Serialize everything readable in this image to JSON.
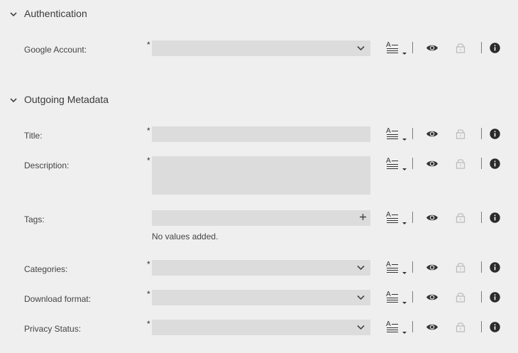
{
  "sections": [
    {
      "title": "Authentication"
    },
    {
      "title": "Outgoing Metadata"
    }
  ],
  "fields": {
    "google_account": {
      "label": "Google Account:",
      "required_mark": "*"
    },
    "title": {
      "label": "Title:",
      "required_mark": "*"
    },
    "description": {
      "label": "Description:",
      "required_mark": "*"
    },
    "tags": {
      "label": "Tags:",
      "empty_note": "No values added."
    },
    "categories": {
      "label": "Categories:",
      "required_mark": "*"
    },
    "download_format": {
      "label": "Download format:",
      "required_mark": "*"
    },
    "privacy_status": {
      "label": "Privacy Status:",
      "required_mark": "*"
    }
  },
  "toolbar": {
    "format_glyph": "A",
    "icons": [
      "text-format-icon",
      "eye-icon",
      "lock-icon",
      "info-icon"
    ]
  },
  "colors": {
    "background": "#efefef",
    "field": "#dcdcdc",
    "icon": "#333333",
    "lock_disabled": "#bdbdbd"
  }
}
